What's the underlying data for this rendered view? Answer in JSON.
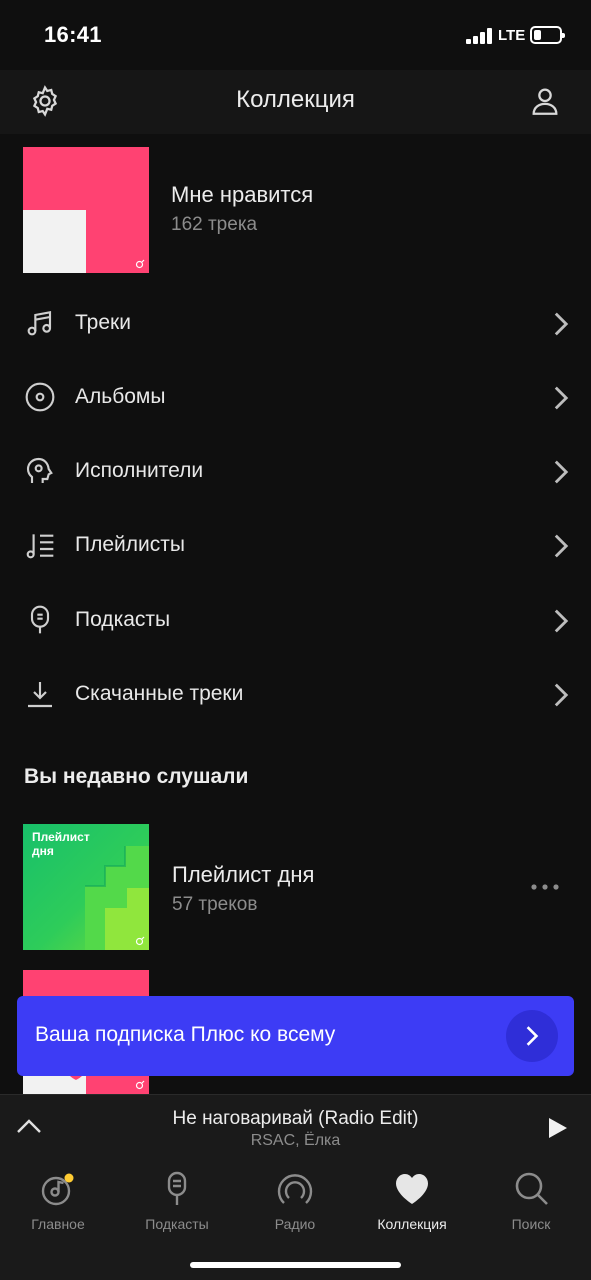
{
  "status": {
    "time": "16:41",
    "network": "LTE"
  },
  "header": {
    "title": "Коллекция"
  },
  "liked": {
    "title": "Мне нравится",
    "subtitle": "162 трека"
  },
  "menu": [
    {
      "label": "Треки",
      "icon": "music-note-icon"
    },
    {
      "label": "Альбомы",
      "icon": "disc-icon"
    },
    {
      "label": "Исполнители",
      "icon": "artist-icon"
    },
    {
      "label": "Плейлисты",
      "icon": "playlist-icon"
    },
    {
      "label": "Подкасты",
      "icon": "microphone-icon"
    },
    {
      "label": "Скачанные треки",
      "icon": "download-icon"
    }
  ],
  "recent": {
    "section_title": "Вы недавно слушали",
    "items": [
      {
        "cover_caption": "Плейлист дня",
        "title": "Плейлист дня",
        "subtitle": "57 треков"
      }
    ]
  },
  "promo": {
    "text": "Ваша подписка Плюс ко всему"
  },
  "player": {
    "song": "Не наговаривай (Radio Edit)",
    "artist": "RSAC, Ёлка"
  },
  "tabs": [
    {
      "label": "Главное",
      "icon": "home-music-icon",
      "badge": true
    },
    {
      "label": "Подкасты",
      "icon": "microphone-icon"
    },
    {
      "label": "Радио",
      "icon": "radio-icon"
    },
    {
      "label": "Коллекция",
      "icon": "heart-icon",
      "active": true
    },
    {
      "label": "Поиск",
      "icon": "search-icon"
    }
  ],
  "colors": {
    "accent_pink": "#ff4272",
    "promo_blue": "#3d3cf5",
    "badge_yellow": "#ffcc33",
    "background": "#0f0f0f"
  }
}
